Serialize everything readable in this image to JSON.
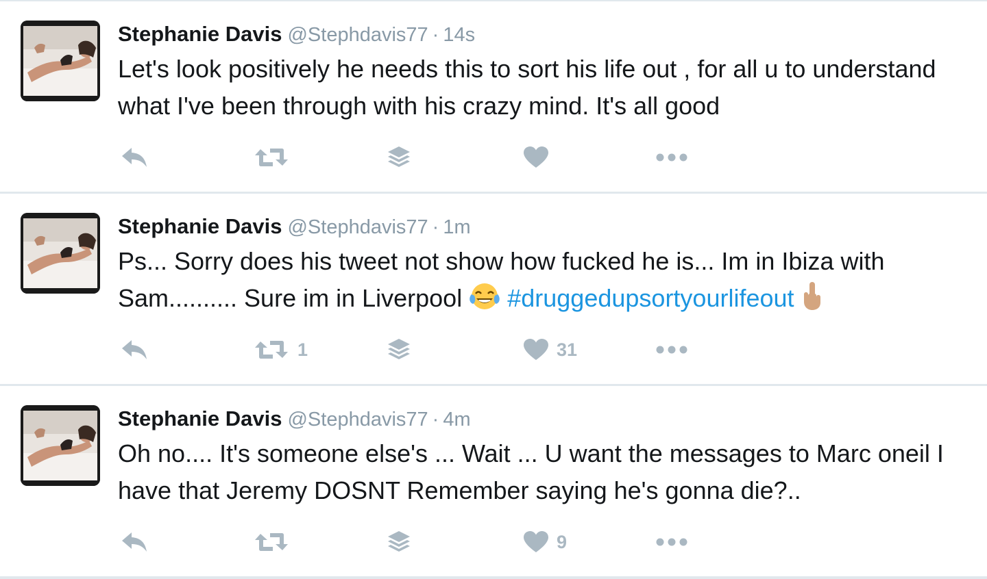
{
  "colors": {
    "name": "#14171a",
    "meta": "#8899a6",
    "hashtag": "#1b95e0",
    "action_icon": "#aab8c2",
    "separator": "#e1e8ed"
  },
  "tweets": [
    {
      "name": "Stephanie Davis",
      "handle": "@Stephdavis77",
      "separator": "·",
      "time": "14s",
      "text": "Let's look positively he needs this to sort his life out , for all u to understand what I've been through with his crazy mind. It's all good",
      "retweet_count": "",
      "like_count": ""
    },
    {
      "name": "Stephanie Davis",
      "handle": "@Stephdavis77",
      "separator": "·",
      "time": "1m",
      "text": "Ps... Sorry does his tweet not show how fucked he is... Im in Ibiza with Sam.......... Sure im in Liverpool",
      "emoji_1": "face-with-tears-of-joy",
      "hashtag": "#druggedupsortyourlifeout",
      "emoji_2": "middle-finger",
      "retweet_count": "1",
      "like_count": "31"
    },
    {
      "name": "Stephanie Davis",
      "handle": "@Stephdavis77",
      "separator": "·",
      "time": "4m",
      "text": "Oh no.... It's someone else's ... Wait ... U want the messages to Marc oneil I have that Jeremy DOSNT Remember saying he's gonna die?..",
      "retweet_count": "",
      "like_count": "9"
    }
  ],
  "icons": {
    "reply": "reply-icon",
    "retweet": "retweet-icon",
    "stack": "layers-icon",
    "like": "heart-icon",
    "more": "more-dots-icon"
  }
}
